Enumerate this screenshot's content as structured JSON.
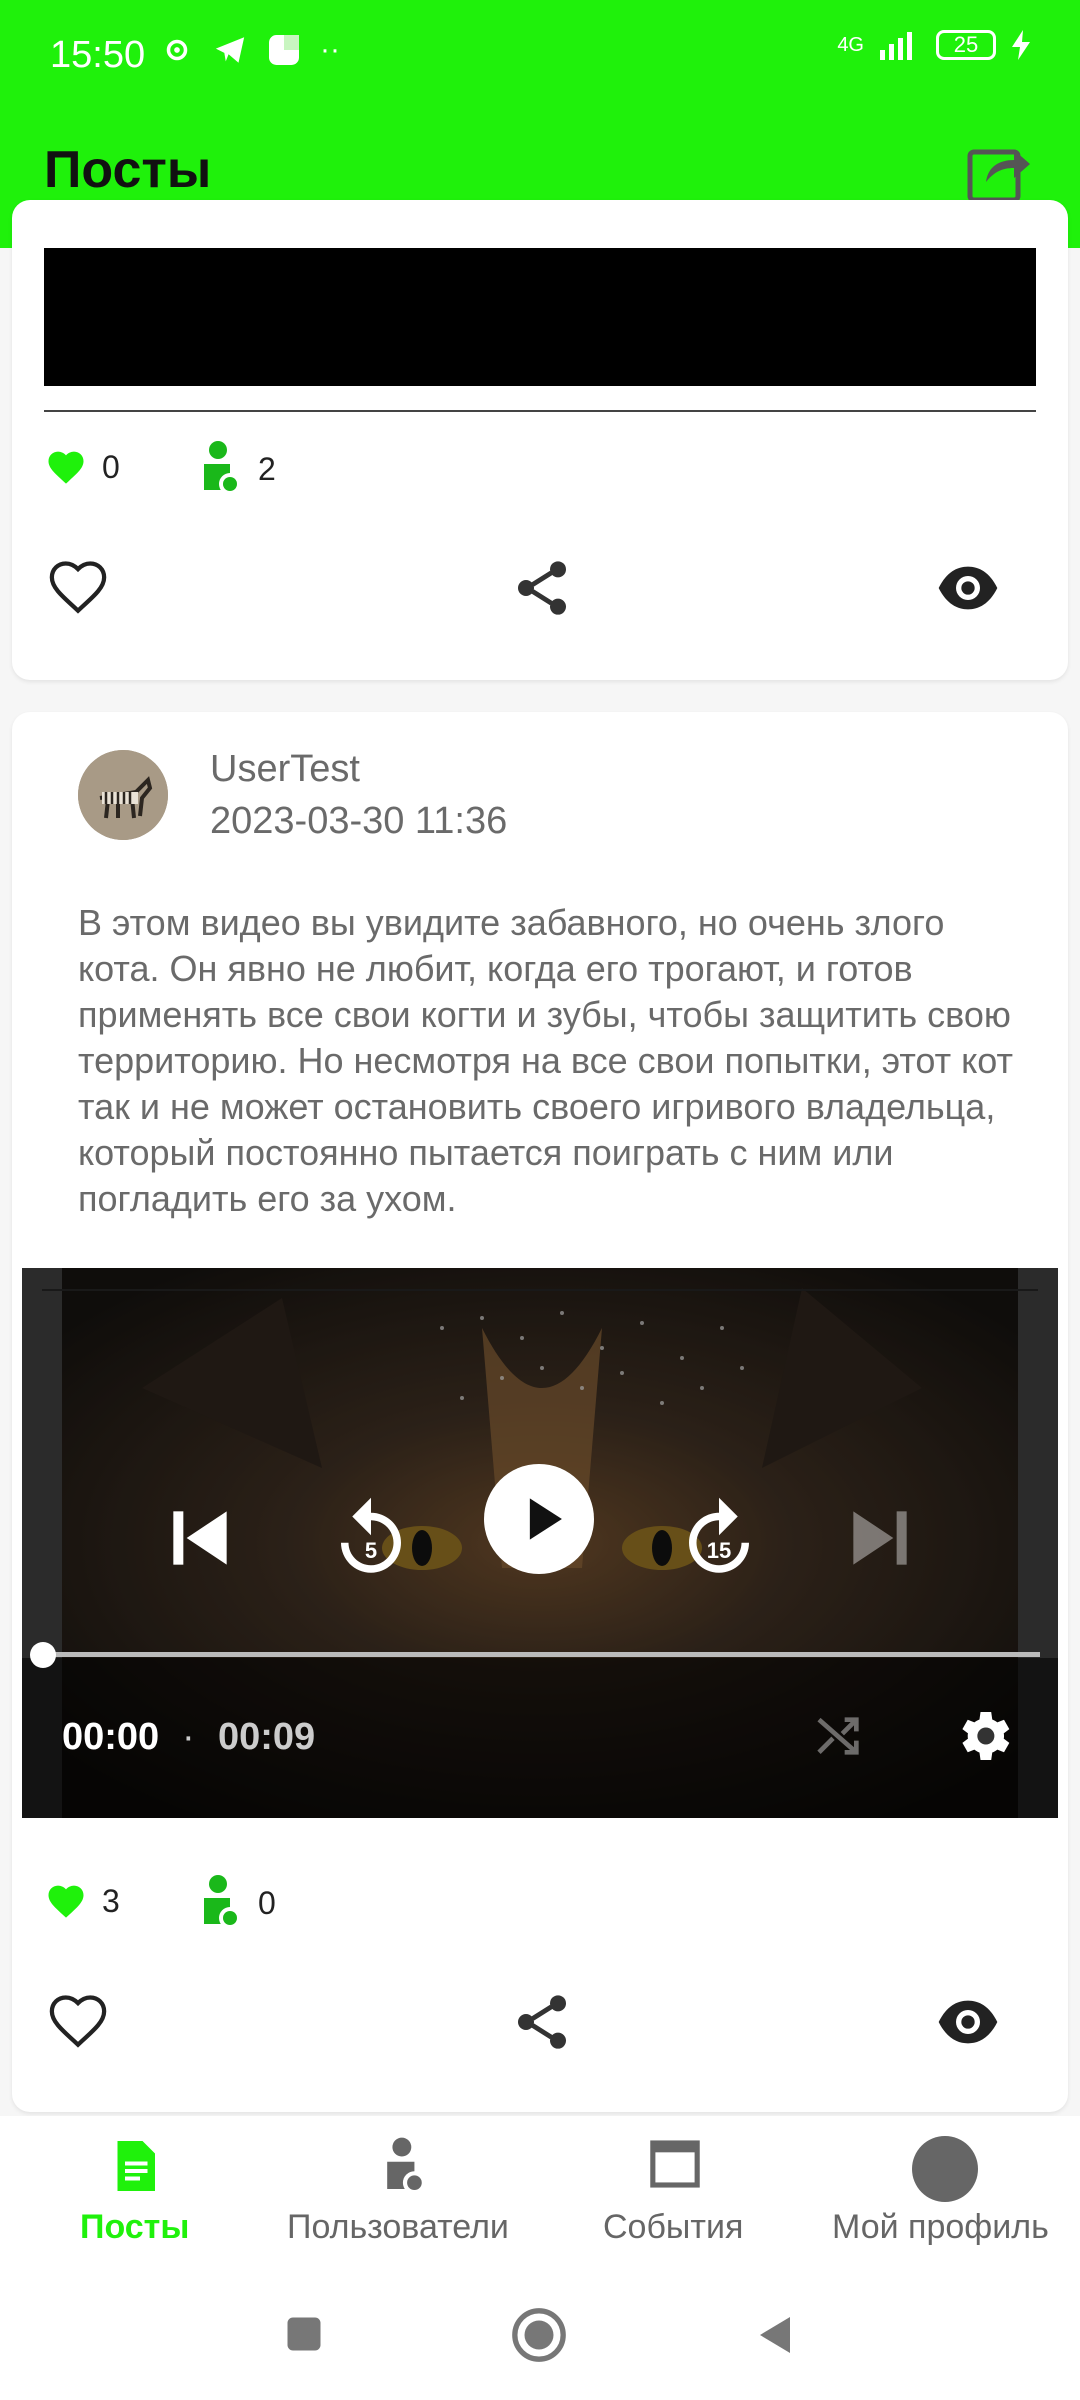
{
  "status_bar": {
    "time": "15:50",
    "network": "4G",
    "battery": "25"
  },
  "app_bar": {
    "title": "Посты"
  },
  "post1": {
    "likes": "0",
    "users": "2"
  },
  "post2": {
    "username": "UserTest",
    "timestamp": "2023-03-30 11:36",
    "text": "В этом видео вы увидите забавного, но очень злого кота. Он явно не любит, когда его трогают, и готов применять все свои когти и зубы, чтобы защитить свою территорию. Но несмотря на все свои попытки, этот кот так и не может остановить своего игривого владельца, который постоянно пытается поиграть с ним или погладить его за ухом.",
    "video": {
      "current_time": "00:00",
      "separator": "·",
      "duration": "00:09",
      "progress": 0,
      "rewind_label": "5",
      "forward_label": "15"
    },
    "likes": "3",
    "users": "0"
  },
  "bottom_nav": {
    "items": [
      {
        "label": "Посты",
        "active": true
      },
      {
        "label": "Пользователи",
        "active": false
      },
      {
        "label": "События",
        "active": false
      },
      {
        "label": "Мой профиль",
        "active": false
      }
    ]
  },
  "colors": {
    "accent": "#1ff10b",
    "text_muted": "#6a6a6a"
  }
}
